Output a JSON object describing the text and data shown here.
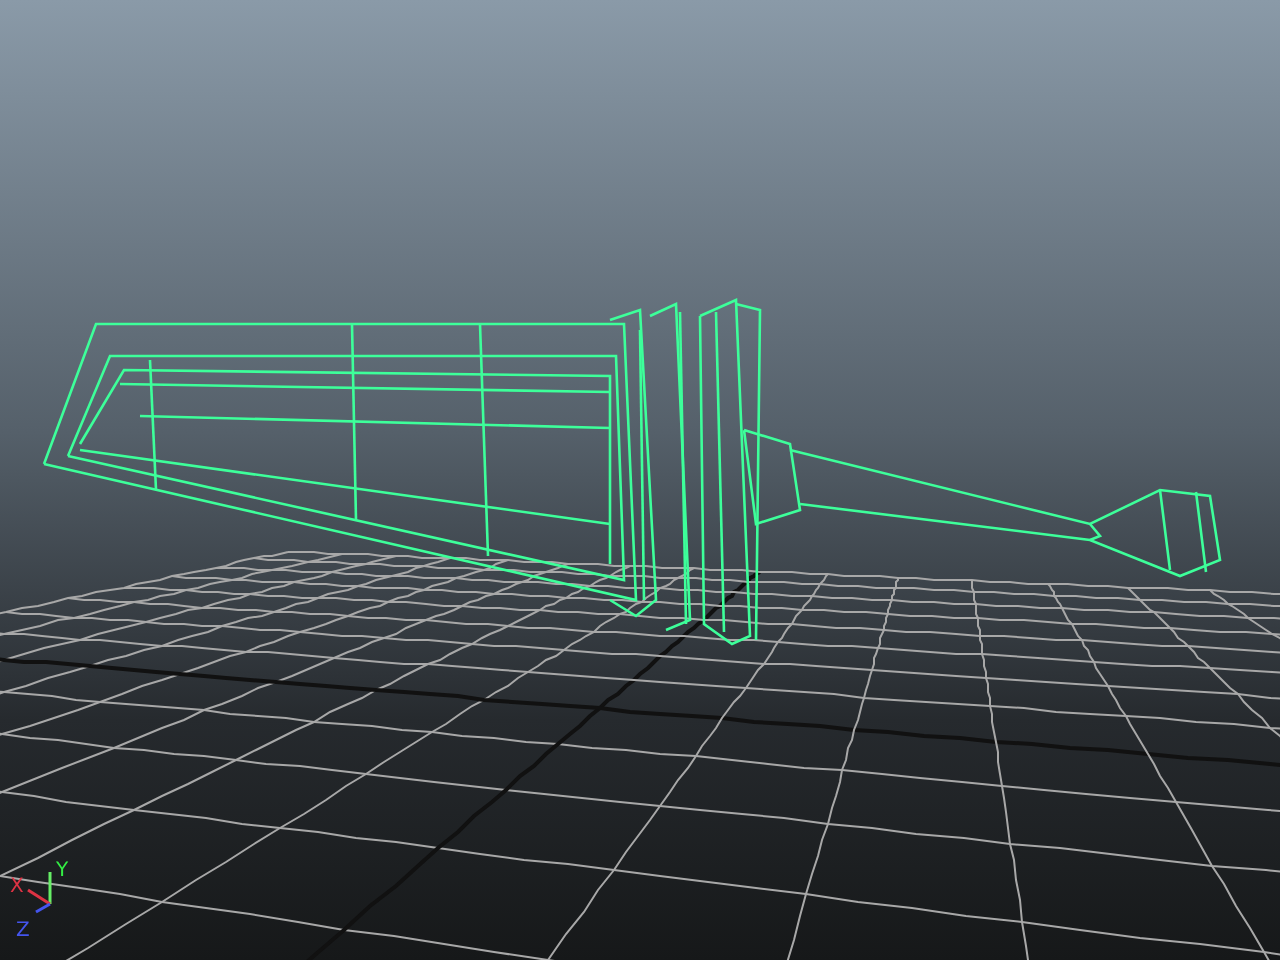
{
  "viewport": {
    "axis_labels": [
      {
        "text": "Y",
        "color": "#33ee44"
      },
      {
        "text": "X",
        "color": "#dd3344"
      },
      {
        "text": "Z",
        "color": "#4455ee"
      }
    ]
  }
}
